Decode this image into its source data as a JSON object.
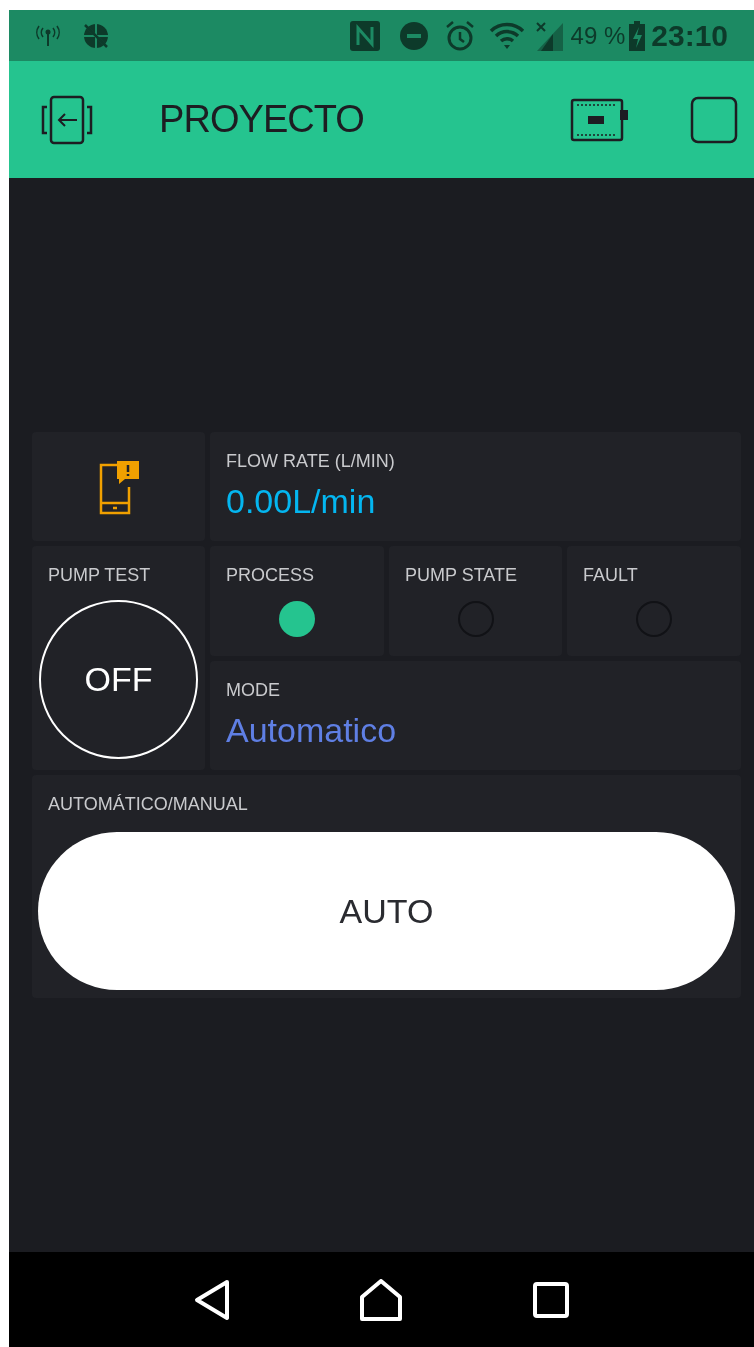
{
  "status_bar": {
    "battery": "49 %",
    "time": "23:10"
  },
  "header": {
    "title": "PROYECTO"
  },
  "widgets": [
    {
      "kind": "notification"
    },
    {
      "kind": "display",
      "label": "FLOW RATE (L/MIN)",
      "value": "0.00L/min",
      "color": "#04b6f0"
    },
    {
      "kind": "round_button",
      "label": "PUMP TEST",
      "value": "OFF",
      "on": false
    },
    {
      "kind": "led",
      "label": "PROCESS",
      "on": true
    },
    {
      "kind": "led",
      "label": "PUMP STATE",
      "on": false
    },
    {
      "kind": "led",
      "label": "FAULT",
      "on": false
    },
    {
      "kind": "display",
      "label": "MODE",
      "value": "Automatico",
      "color": "#5f7fe4"
    },
    {
      "kind": "wide_button",
      "label": "AUTOMÁTICO/MANUAL",
      "value": "AUTO",
      "on": true
    }
  ]
}
